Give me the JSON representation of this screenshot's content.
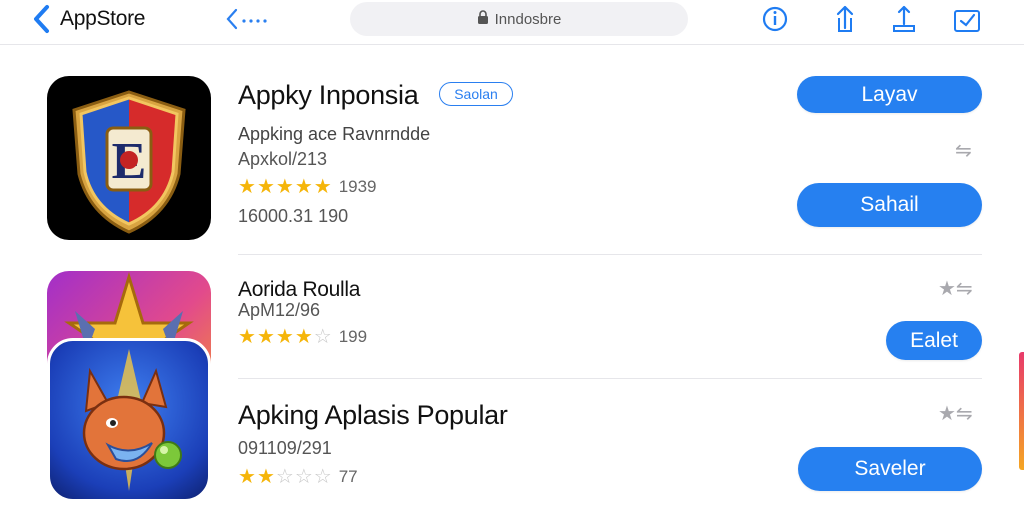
{
  "header": {
    "back_label": "AppStore",
    "url": "Inndosbre"
  },
  "apps": [
    {
      "title": "Appky Inponsia",
      "badge": "Saolan",
      "subtitle": "Appking ace Ravnrndde",
      "meta": "Apxkol/213",
      "rating_stars": 5,
      "rating_count": "1939",
      "downloads": "16000.31 190",
      "buttons": [
        "Layav",
        "Sahail"
      ]
    },
    {
      "title": "Aorida Roulla",
      "meta": "ApM12/96",
      "rating_stars": 4,
      "rating_count": "199",
      "buttons": [
        "Ealet"
      ]
    },
    {
      "title": "Apking Aplasis Popular",
      "meta": "091109/291",
      "rating_stars": 2,
      "rating_count": "77",
      "buttons": [
        "Saveler"
      ]
    }
  ],
  "colors": {
    "accent": "#2680f0",
    "star": "#f5b50a"
  }
}
